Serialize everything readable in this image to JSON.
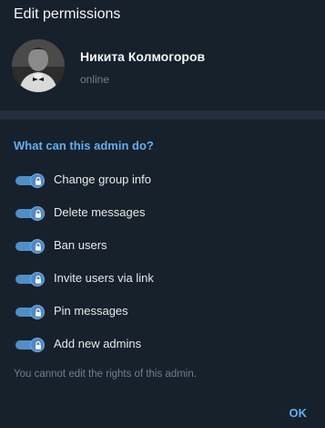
{
  "dialog": {
    "title": "Edit permissions"
  },
  "user": {
    "name": "Никита Колмогоров",
    "status": "online",
    "avatar_icon": "user-photo"
  },
  "rights": {
    "header": "What can this admin do?",
    "items": [
      {
        "label": "Change group info",
        "enabled": true,
        "locked": true
      },
      {
        "label": "Delete messages",
        "enabled": true,
        "locked": true
      },
      {
        "label": "Ban users",
        "enabled": true,
        "locked": true
      },
      {
        "label": "Invite users via link",
        "enabled": true,
        "locked": true
      },
      {
        "label": "Pin messages",
        "enabled": true,
        "locked": true
      },
      {
        "label": "Add new admins",
        "enabled": true,
        "locked": true
      }
    ],
    "note": "You cannot edit the rights of this admin."
  },
  "actions": {
    "ok_label": "OK"
  },
  "colors": {
    "background": "#17212b",
    "separator": "#232e3c",
    "accent": "#5eaff2",
    "toggle_on": "#4f8fc6",
    "muted_text": "#6d7f8f"
  }
}
